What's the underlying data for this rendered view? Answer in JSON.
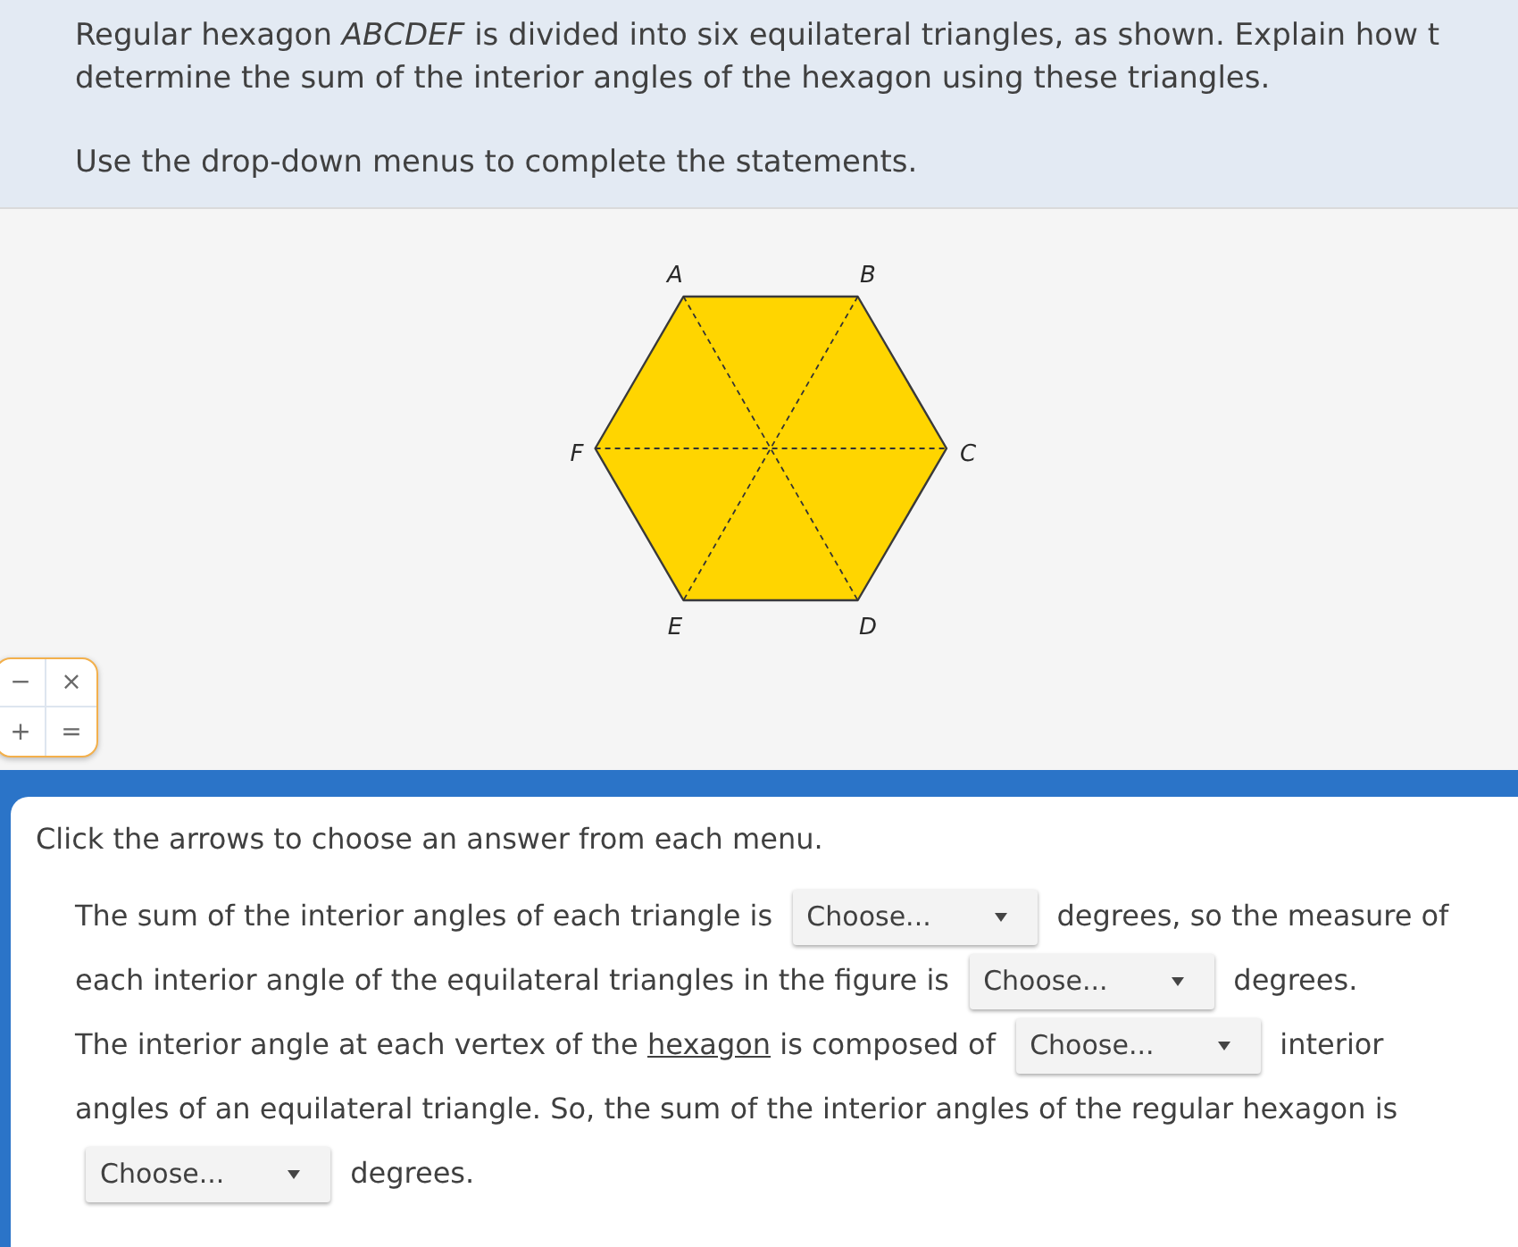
{
  "prompt": {
    "text": "Regular hexagon *ABCDEF* is divided into six equilateral triangles, as shown. Explain how t\ndetermine the sum of the interior angles of the hexagon using these triangles.",
    "instruction": "Use the drop-down menus to complete the statements."
  },
  "figure": {
    "vertex_labels": [
      "A",
      "B",
      "C",
      "D",
      "E",
      "F"
    ]
  },
  "calculator": {
    "keys": [
      "−",
      "×",
      "+",
      "="
    ]
  },
  "answer_panel": {
    "instruction": "Click the arrows to choose an answer from each menu.",
    "statements": [
      [
        {
          "kind": "text",
          "text": "The sum of the interior angles of each triangle is"
        },
        {
          "kind": "dropdown",
          "label": "Choose..."
        },
        {
          "kind": "text",
          "text": "degrees, so the measure of"
        },
        {
          "kind": "text",
          "text": "each interior angle of the equilateral triangles in the figure is"
        },
        {
          "kind": "dropdown",
          "label": "Choose..."
        },
        {
          "kind": "text",
          "text": "degrees."
        }
      ],
      [
        {
          "kind": "text",
          "text": "The interior angle at each vertex of the"
        },
        {
          "kind": "link",
          "text": "hexagon"
        },
        {
          "kind": "text",
          "text": "is composed of"
        },
        {
          "kind": "dropdown",
          "label": "Choose..."
        },
        {
          "kind": "text",
          "text": "interior"
        },
        {
          "kind": "text",
          "text": "angles of an equilateral triangle. So, the sum of the interior angles of the regular hexagon is"
        },
        {
          "kind": "dropdown",
          "label": "Choose..."
        },
        {
          "kind": "text",
          "text": "degrees."
        }
      ]
    ]
  }
}
